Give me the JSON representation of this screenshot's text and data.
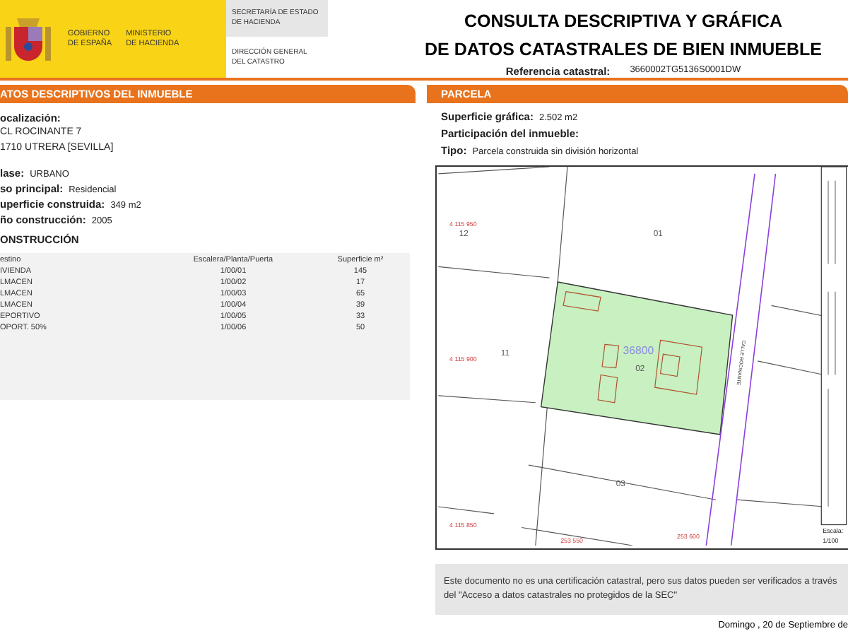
{
  "header": {
    "gobierno": "GOBIERNO\nDE ESPAÑA",
    "ministerio": "MINISTERIO\nDE HACIENDA",
    "secretaria": "SECRETARÍA DE ESTADO\nDE HACIENDA",
    "direccion": "DIRECCIÓN GENERAL\nDEL CATASTRO"
  },
  "title": [
    "CONSULTA DESCRIPTIVA Y GRÁFICA",
    "DE DATOS CATASTRALES DE BIEN INMUEBLE"
  ],
  "reference": {
    "label": "Referencia catastral:",
    "value": "3660002TG5136S0001DW"
  },
  "inmueble": {
    "heading": "ATOS DESCRIPTIVOS DEL INMUEBLE",
    "location_label": "ocalización:",
    "address": [
      "CL ROCINANTE 7",
      "1710 UTRERA [SEVILLA]"
    ],
    "fields": [
      {
        "label": "lase:",
        "value": "URBANO"
      },
      {
        "label": "so principal:",
        "value": "Residencial"
      },
      {
        "label": "uperficie construida:",
        "value": "349 m2"
      },
      {
        "label": "ño construcción:",
        "value": "2005"
      }
    ],
    "construction_heading": "ONSTRUCCIÓN",
    "table": {
      "columns": [
        "estino",
        "Escalera/Planta/Puerta",
        "Superficie m²"
      ],
      "rows": [
        [
          "IVIENDA",
          "1/00/01",
          "145"
        ],
        [
          "LMACEN",
          "1/00/02",
          "17"
        ],
        [
          "LMACEN",
          "1/00/03",
          "65"
        ],
        [
          "LMACEN",
          "1/00/04",
          "39"
        ],
        [
          "EPORTIVO",
          "1/00/05",
          "33"
        ],
        [
          "OPORT. 50%",
          "1/00/06",
          "50"
        ]
      ]
    }
  },
  "parcela": {
    "heading": "PARCELA",
    "fields": [
      {
        "label": "Superficie gráfica:",
        "value": "2.502 m2"
      },
      {
        "label": "Participación del inmueble:"
      },
      {
        "label": "Tipo:",
        "value": "Parcela construida sin división horizontal"
      }
    ],
    "map": {
      "parcels": [
        "12",
        "01",
        "11",
        "02",
        "03"
      ],
      "block": "36800",
      "street": "CALLE ROCINANTE",
      "northings": [
        "4 115 950",
        "4 115 900",
        "4 115 850"
      ],
      "eastings": [
        "253 550",
        "253 600"
      ],
      "scale_label": "Escala:",
      "scale": "1/100"
    }
  },
  "notice": "Este documento no es una certificación catastral, pero sus datos pueden ser verificados a través del \"Acceso a datos catastrales no protegidos de la SEC\"",
  "date": "Domingo , 20 de Septiembre de"
}
